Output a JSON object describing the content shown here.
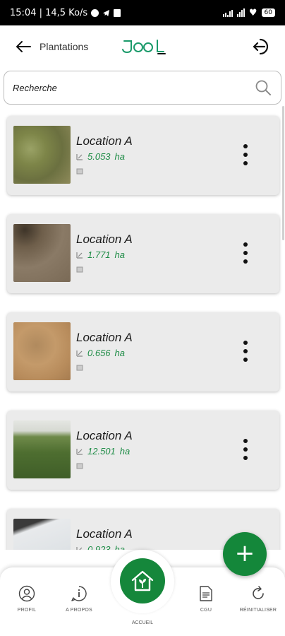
{
  "status_bar": {
    "time_speed": "15:04 | 14,5 Ko/s",
    "battery": "60"
  },
  "header": {
    "title": "Plantations",
    "logo_text": "JOOL"
  },
  "search": {
    "placeholder": "Recherche"
  },
  "plantations": [
    {
      "name": "Location A",
      "area": "5.053",
      "unit": "ha",
      "thumb": "grass-dry"
    },
    {
      "name": "Location A",
      "area": "1.771",
      "unit": "ha",
      "thumb": "soil-dark"
    },
    {
      "name": "Location A",
      "area": "0.656",
      "unit": "ha",
      "thumb": "soil-sand"
    },
    {
      "name": "Location A",
      "area": "12.501",
      "unit": "ha",
      "thumb": "grass-field"
    },
    {
      "name": "Location A",
      "area": "0.923",
      "unit": "ha",
      "thumb": "pale-sky"
    }
  ],
  "fab": {
    "icon": "plus-icon"
  },
  "bottom_nav": {
    "profil": "PROFIL",
    "apropos": "A PROPOS",
    "accueil": "ACCUEIL",
    "cgu": "CGU",
    "reinitialiser": "RÉINITIALISER"
  },
  "colors": {
    "accent": "#15873b",
    "area_text": "#1e8c46",
    "card_bg": "#ebebeb"
  }
}
